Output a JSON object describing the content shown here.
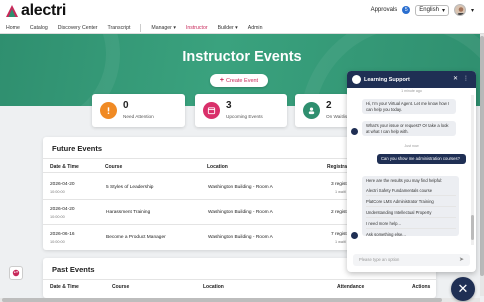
{
  "brand": {
    "name": "alectri",
    "accent": "#c8285a",
    "green": "#2f8f6f",
    "navy": "#1f2f54"
  },
  "topbar": {
    "approvals_label": "Approvals",
    "approvals_count": "5",
    "language": "English"
  },
  "nav": {
    "home": "Home",
    "catalog": "Catalog",
    "discovery": "Discovery Center",
    "transcript": "Transcript",
    "manager": "Manager ▾",
    "instructor": "Instructor",
    "builder": "Builder ▾",
    "admin": "Admin"
  },
  "hero": {
    "title": "Instructor Events",
    "create_label": "Create Event"
  },
  "stats": [
    {
      "value": "0",
      "label": "Need Attention",
      "icon": "alert-icon",
      "color": "#f08a24"
    },
    {
      "value": "3",
      "label": "Upcoming Events",
      "icon": "calendar-icon",
      "color": "#d9306a"
    },
    {
      "value": "2",
      "label": "On Waitlist",
      "icon": "users-icon",
      "color": "#2f8f6f"
    }
  ],
  "future": {
    "title": "Future Events",
    "headers": {
      "date": "Date & Time",
      "course": "Course",
      "location": "Location",
      "reg": "Registrat"
    },
    "rows": [
      {
        "date": "2026-04-20",
        "time": "10:00:00",
        "course": "5 Styles of Leadership",
        "location": "Washington Building - Room A",
        "reg": "3 registe",
        "reg_sub": "1 waitl"
      },
      {
        "date": "2026-04-20",
        "time": "10:00:00",
        "course": "Harassment Training",
        "location": "Washington Building - Room A",
        "reg": "2 registe",
        "reg_sub": ""
      },
      {
        "date": "2026-06-16",
        "time": "10:00:00",
        "course": "Become a Product Manager",
        "location": "Washington Building - Room A",
        "reg": "7 registe",
        "reg_sub": "1 waitl"
      }
    ]
  },
  "past": {
    "title": "Past Events",
    "headers": {
      "date": "Date & Time",
      "course": "Course",
      "location": "Location",
      "attendance": "Attendance",
      "actions": "Actions"
    }
  },
  "chat": {
    "title": "Learning Support",
    "ts1": "1 minute ago",
    "msg1": "Hi, I'm your Virtual Agent. Let me know how I can help you today.",
    "msg2": "What's your issue or request? Or take a look at what I can help with.",
    "ts2": "Just now",
    "user_msg": "Can you show me administration courses?",
    "results_intro": "Here are the results you may find helpful:",
    "options": [
      "Alectri Safety Fundamentals course",
      "PlatCore LMS Administrator Training",
      "Understanding Intellectual Property",
      "I need more help..."
    ],
    "ask_else": "Ask something else...",
    "input_placeholder": "Please type an option"
  }
}
